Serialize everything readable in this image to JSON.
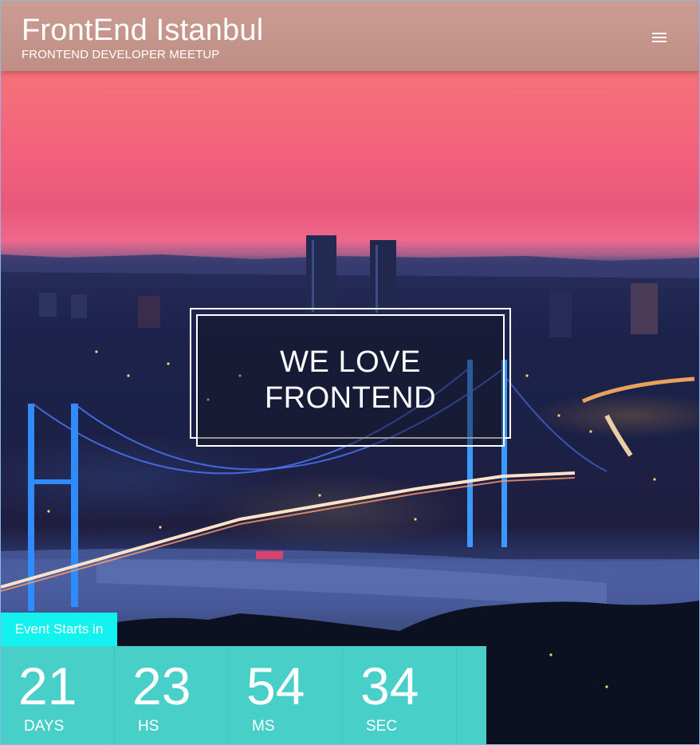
{
  "header": {
    "title": "FrontEnd Istanbul",
    "subtitle": "FRONTEND DEVELOPER MEETUP",
    "menu_icon": "hamburger-menu-icon"
  },
  "hero": {
    "tagline": "WE LOVE FRONTEND"
  },
  "countdown": {
    "label": "Event Starts in",
    "items": [
      {
        "value": "21",
        "unit": "DAYS"
      },
      {
        "value": "23",
        "unit": "HS"
      },
      {
        "value": "54",
        "unit": "MS"
      },
      {
        "value": "34",
        "unit": "SEC"
      }
    ]
  },
  "colors": {
    "countdown_bg": "#47cfc8",
    "countdown_label_bg": "#13f2ef",
    "header_bg": "#c8a096"
  }
}
